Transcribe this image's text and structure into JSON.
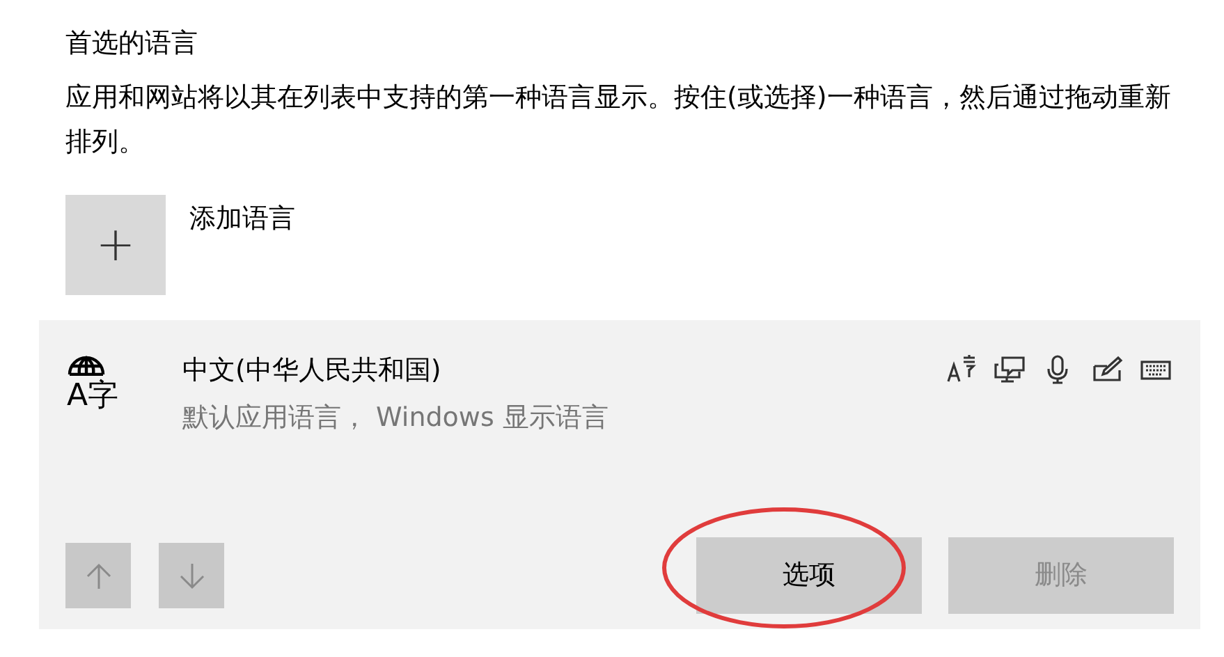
{
  "section_title": "首选的语言",
  "description": "应用和网站将以其在列表中支持的第一种语言显示。按住(或选择)一种语言，然后通过拖动重新排列。",
  "add_language": {
    "icon": "+",
    "label": "添加语言"
  },
  "language": {
    "icon_text": "A字",
    "name": "中文(中华人民共和国)",
    "detail": "默认应用语言， Windows 显示语言",
    "features": [
      {
        "kind": "text"
      },
      {
        "kind": "speech_display"
      },
      {
        "kind": "microphone"
      },
      {
        "kind": "handwriting"
      },
      {
        "kind": "keyboard"
      }
    ],
    "move_buttons": [
      {
        "kind": "up",
        "disabled": true
      },
      {
        "kind": "down",
        "disabled": true
      }
    ],
    "buttons": [
      {
        "label": "选项",
        "disabled": false
      },
      {
        "label": "删除",
        "disabled": true
      }
    ]
  },
  "annotation": {
    "kind": "ellipse",
    "color": "#e03c3c"
  }
}
